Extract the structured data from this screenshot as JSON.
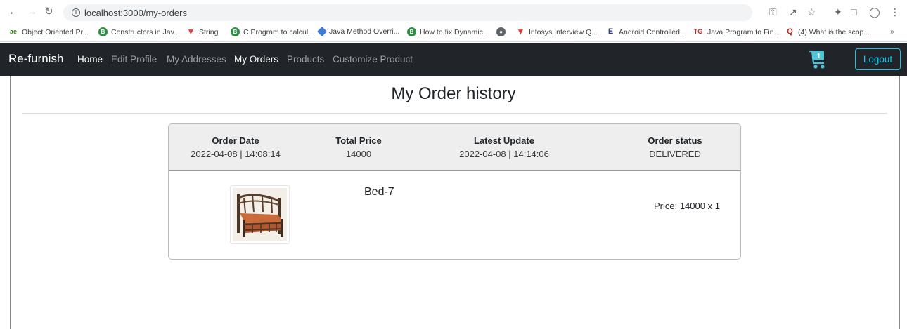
{
  "browser": {
    "url": "localhost:3000/my-orders",
    "bookmarks": [
      {
        "label": "Object Oriented Pr...",
        "icon": "object-oriented-bookmark-icon"
      },
      {
        "label": "Constructors in Jav...",
        "icon": "green-b-bookmark-icon"
      },
      {
        "label": "String",
        "icon": "red-v-bookmark-icon"
      },
      {
        "label": "C Program to calcul...",
        "icon": "green-b-bookmark-icon"
      },
      {
        "label": "Java Method Overri...",
        "icon": "blue-diamond-bookmark-icon"
      },
      {
        "label": "How to fix Dynamic...",
        "icon": "green-b-bookmark-icon"
      },
      {
        "label": "",
        "icon": "globe-bookmark-icon"
      },
      {
        "label": "Infosys Interview Q...",
        "icon": "red-v-bookmark-icon"
      },
      {
        "label": "Android Controlled...",
        "icon": "e-bookmark-icon"
      },
      {
        "label": "Java Program to Fin...",
        "icon": "tg-bookmark-icon"
      },
      {
        "label": "(4) What is the scop...",
        "icon": "quora-bookmark-icon"
      }
    ],
    "more_bookmarks": "»"
  },
  "navbar": {
    "brand": "Re-furnish",
    "links": [
      {
        "label": "Home",
        "active": true
      },
      {
        "label": "Edit Profile",
        "active": false
      },
      {
        "label": "My Addresses",
        "active": false
      },
      {
        "label": "My Orders",
        "active": true
      },
      {
        "label": "Products",
        "active": false
      },
      {
        "label": "Customize Product",
        "active": false
      }
    ],
    "cart_count": "1",
    "logout_label": "Logout"
  },
  "page": {
    "title": "My Order history"
  },
  "order": {
    "headers": {
      "date": "Order Date",
      "total": "Total Price",
      "update": "Latest Update",
      "status": "Order status"
    },
    "values": {
      "date": "2022-04-08 | 14:08:14",
      "total": "14000",
      "update": "2022-04-08 | 14:14:06",
      "status": "DELIVERED"
    },
    "item": {
      "name": "Bed-7",
      "price": "Price: 14000 x 1"
    }
  },
  "colors": {
    "navbar_bg": "#212529",
    "logout_accent": "#0dcaf0",
    "cart_accent": "#4fc3d8"
  }
}
